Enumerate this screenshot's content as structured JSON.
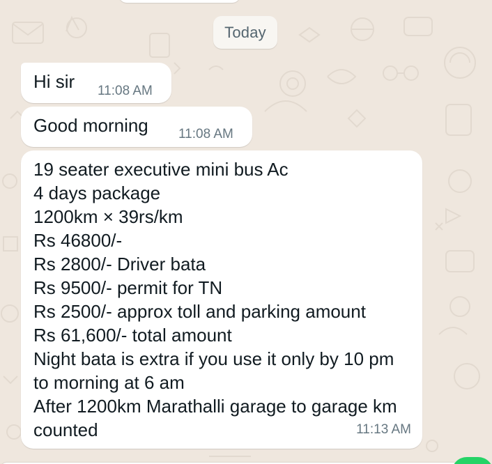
{
  "date_separator": "Today",
  "messages": [
    {
      "text": "Hi sir",
      "time": "11:08 AM"
    },
    {
      "text": "Good morning",
      "time": "11:08 AM"
    },
    {
      "text": "19 seater executive mini bus Ac\n4 days package\n1200km × 39rs/km\nRs 46800/-\nRs 2800/- Driver bata\nRs 9500/- permit for TN\nRs 2500/- approx toll and parking amount\nRs 61,600/- total amount\nNight bata is extra if you use it only by 10 pm to morning at 6 am\nAfter 1200km Marathalli garage to garage km counted",
      "time": "11:13 AM"
    }
  ],
  "colors": {
    "wallpaper": "#efe7de",
    "bubble": "#ffffff",
    "timestamp": "#667781",
    "date_chip_text": "#54656f",
    "fab": "#25d366"
  }
}
